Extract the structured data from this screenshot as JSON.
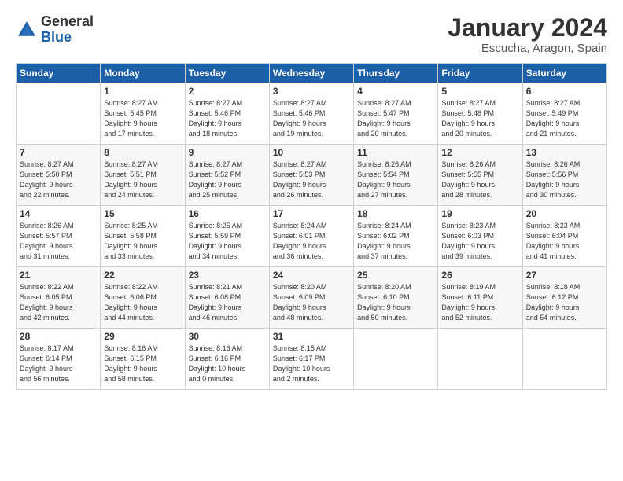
{
  "header": {
    "logo_line1": "General",
    "logo_line2": "Blue",
    "month": "January 2024",
    "location": "Escucha, Aragon, Spain"
  },
  "weekdays": [
    "Sunday",
    "Monday",
    "Tuesday",
    "Wednesday",
    "Thursday",
    "Friday",
    "Saturday"
  ],
  "weeks": [
    [
      {
        "day": "",
        "info": ""
      },
      {
        "day": "1",
        "info": "Sunrise: 8:27 AM\nSunset: 5:45 PM\nDaylight: 9 hours\nand 17 minutes."
      },
      {
        "day": "2",
        "info": "Sunrise: 8:27 AM\nSunset: 5:46 PM\nDaylight: 9 hours\nand 18 minutes."
      },
      {
        "day": "3",
        "info": "Sunrise: 8:27 AM\nSunset: 5:46 PM\nDaylight: 9 hours\nand 19 minutes."
      },
      {
        "day": "4",
        "info": "Sunrise: 8:27 AM\nSunset: 5:47 PM\nDaylight: 9 hours\nand 20 minutes."
      },
      {
        "day": "5",
        "info": "Sunrise: 8:27 AM\nSunset: 5:48 PM\nDaylight: 9 hours\nand 20 minutes."
      },
      {
        "day": "6",
        "info": "Sunrise: 8:27 AM\nSunset: 5:49 PM\nDaylight: 9 hours\nand 21 minutes."
      }
    ],
    [
      {
        "day": "7",
        "info": "Sunrise: 8:27 AM\nSunset: 5:50 PM\nDaylight: 9 hours\nand 22 minutes."
      },
      {
        "day": "8",
        "info": "Sunrise: 8:27 AM\nSunset: 5:51 PM\nDaylight: 9 hours\nand 24 minutes."
      },
      {
        "day": "9",
        "info": "Sunrise: 8:27 AM\nSunset: 5:52 PM\nDaylight: 9 hours\nand 25 minutes."
      },
      {
        "day": "10",
        "info": "Sunrise: 8:27 AM\nSunset: 5:53 PM\nDaylight: 9 hours\nand 26 minutes."
      },
      {
        "day": "11",
        "info": "Sunrise: 8:26 AM\nSunset: 5:54 PM\nDaylight: 9 hours\nand 27 minutes."
      },
      {
        "day": "12",
        "info": "Sunrise: 8:26 AM\nSunset: 5:55 PM\nDaylight: 9 hours\nand 28 minutes."
      },
      {
        "day": "13",
        "info": "Sunrise: 8:26 AM\nSunset: 5:56 PM\nDaylight: 9 hours\nand 30 minutes."
      }
    ],
    [
      {
        "day": "14",
        "info": "Sunrise: 8:26 AM\nSunset: 5:57 PM\nDaylight: 9 hours\nand 31 minutes."
      },
      {
        "day": "15",
        "info": "Sunrise: 8:25 AM\nSunset: 5:58 PM\nDaylight: 9 hours\nand 33 minutes."
      },
      {
        "day": "16",
        "info": "Sunrise: 8:25 AM\nSunset: 5:59 PM\nDaylight: 9 hours\nand 34 minutes."
      },
      {
        "day": "17",
        "info": "Sunrise: 8:24 AM\nSunset: 6:01 PM\nDaylight: 9 hours\nand 36 minutes."
      },
      {
        "day": "18",
        "info": "Sunrise: 8:24 AM\nSunset: 6:02 PM\nDaylight: 9 hours\nand 37 minutes."
      },
      {
        "day": "19",
        "info": "Sunrise: 8:23 AM\nSunset: 6:03 PM\nDaylight: 9 hours\nand 39 minutes."
      },
      {
        "day": "20",
        "info": "Sunrise: 8:23 AM\nSunset: 6:04 PM\nDaylight: 9 hours\nand 41 minutes."
      }
    ],
    [
      {
        "day": "21",
        "info": "Sunrise: 8:22 AM\nSunset: 6:05 PM\nDaylight: 9 hours\nand 42 minutes."
      },
      {
        "day": "22",
        "info": "Sunrise: 8:22 AM\nSunset: 6:06 PM\nDaylight: 9 hours\nand 44 minutes."
      },
      {
        "day": "23",
        "info": "Sunrise: 8:21 AM\nSunset: 6:08 PM\nDaylight: 9 hours\nand 46 minutes."
      },
      {
        "day": "24",
        "info": "Sunrise: 8:20 AM\nSunset: 6:09 PM\nDaylight: 9 hours\nand 48 minutes."
      },
      {
        "day": "25",
        "info": "Sunrise: 8:20 AM\nSunset: 6:10 PM\nDaylight: 9 hours\nand 50 minutes."
      },
      {
        "day": "26",
        "info": "Sunrise: 8:19 AM\nSunset: 6:11 PM\nDaylight: 9 hours\nand 52 minutes."
      },
      {
        "day": "27",
        "info": "Sunrise: 8:18 AM\nSunset: 6:12 PM\nDaylight: 9 hours\nand 54 minutes."
      }
    ],
    [
      {
        "day": "28",
        "info": "Sunrise: 8:17 AM\nSunset: 6:14 PM\nDaylight: 9 hours\nand 56 minutes."
      },
      {
        "day": "29",
        "info": "Sunrise: 8:16 AM\nSunset: 6:15 PM\nDaylight: 9 hours\nand 58 minutes."
      },
      {
        "day": "30",
        "info": "Sunrise: 8:16 AM\nSunset: 6:16 PM\nDaylight: 10 hours\nand 0 minutes."
      },
      {
        "day": "31",
        "info": "Sunrise: 8:15 AM\nSunset: 6:17 PM\nDaylight: 10 hours\nand 2 minutes."
      },
      {
        "day": "",
        "info": ""
      },
      {
        "day": "",
        "info": ""
      },
      {
        "day": "",
        "info": ""
      }
    ]
  ]
}
